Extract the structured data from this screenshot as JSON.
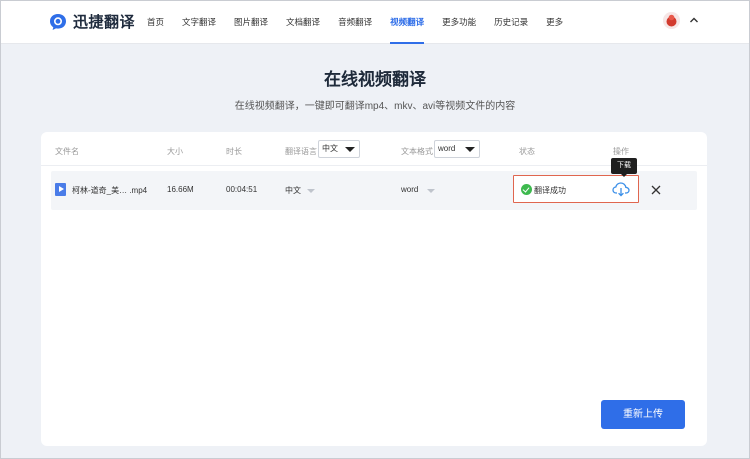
{
  "brand": {
    "name": "迅捷翻译"
  },
  "nav": {
    "items": [
      {
        "label": "首页"
      },
      {
        "label": "文字翻译"
      },
      {
        "label": "图片翻译"
      },
      {
        "label": "文档翻译"
      },
      {
        "label": "音频翻译"
      },
      {
        "label": "视频翻译",
        "active": true
      },
      {
        "label": "更多功能"
      },
      {
        "label": "历史记录"
      },
      {
        "label": "更多"
      }
    ]
  },
  "hero": {
    "title": "在线视频翻译",
    "subtitle": "在线视频翻译，一键即可翻译mp4、mkv、avi等视频文件的内容"
  },
  "table": {
    "headers": {
      "filename": "文件名",
      "size": "大小",
      "duration": "时长",
      "language": "翻译语言",
      "format": "文本格式",
      "status": "状态",
      "actions": "操作"
    },
    "language_select": "中文",
    "format_select": "word",
    "rows": [
      {
        "filename": "柯林-道奇_美…  .mp4",
        "size": "16.66M",
        "duration": "00:04:51",
        "language": "中文",
        "format": "word",
        "status": "翻译成功"
      }
    ]
  },
  "tooltip": {
    "download": "下载"
  },
  "actions": {
    "reupload": "重新上传"
  },
  "colors": {
    "accent": "#2f6ee8",
    "success": "#3db94e",
    "highlight_border": "#e0664f",
    "background": "#eef1f6"
  }
}
